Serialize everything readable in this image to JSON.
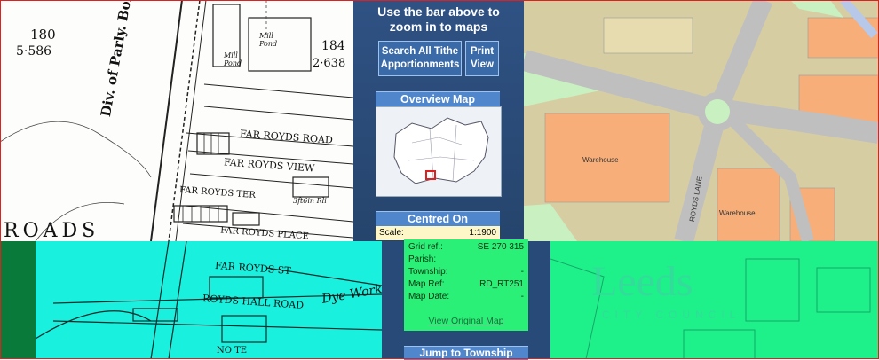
{
  "hist_map": {
    "labels": [
      "180",
      "5·586",
      "184",
      "2·638",
      "FAR ROYDS ROAD",
      "FAR ROYDS VIEW",
      "FAR ROYDS TER",
      "FAR ROYDS PLACE",
      "Div. of Parly. Boro. & Ward By",
      "Mill Pond",
      "Mill Pond",
      "ROADS",
      "3ft6in Rli",
      "FAR ROYDS ST",
      "ROYDS HALL ROAD",
      "Dye Work",
      "NO TE"
    ]
  },
  "panel": {
    "hint": "Use the bar above to zoom in to maps",
    "search_button": "Search All Tithe Apportionments",
    "print_button": "Print View",
    "overview_title": "Overview Map",
    "centred_title": "Centred On",
    "jump_title": "Jump to Township",
    "highlight_color": "#e02020"
  },
  "info": {
    "scale_label": "Scale:",
    "scale_value": "1:1900",
    "grid_label": "Grid ref.:",
    "grid_value": "SE 270 315",
    "parish_label": "Parish:",
    "parish_value": "",
    "township_label": "Township:",
    "township_value": "-",
    "mapref_label": "Map Ref:",
    "mapref_value": "RD_RT251",
    "mapdate_label": "Map Date:",
    "mapdate_value": "-",
    "view_link": "View Original Map"
  },
  "modern_map": {
    "warehouse_1": "Warehouse",
    "warehouse_2": "Warehouse",
    "road_label": "ROYDS LANE"
  },
  "logo": {
    "name": "Leeds",
    "sub": "CITY COUNCIL"
  }
}
